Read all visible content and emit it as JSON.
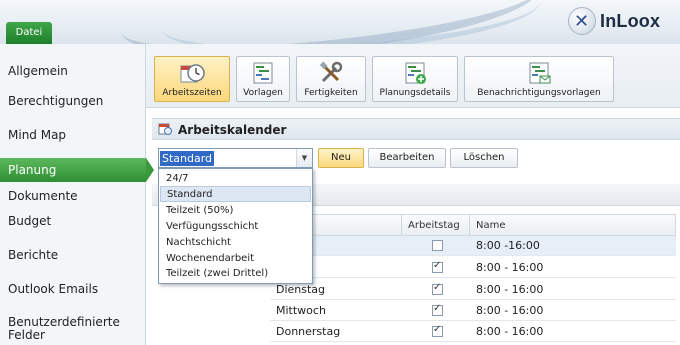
{
  "app": {
    "file_tab": "Datei",
    "brand": "InLoox"
  },
  "sidebar": {
    "items": [
      {
        "label": "Allgemein",
        "active": false
      },
      {
        "label": "Berechtigungen",
        "active": false
      },
      {
        "label": "Mind Map",
        "active": false
      },
      {
        "label": "Planung",
        "active": true
      },
      {
        "label": "Dokumente",
        "active": false
      },
      {
        "label": "Budget",
        "active": false
      },
      {
        "label": "Berichte",
        "active": false
      },
      {
        "label": "Outlook Emails",
        "active": false
      },
      {
        "label": "Benutzerdefinierte Felder",
        "active": false
      }
    ]
  },
  "ribbon": {
    "buttons": [
      {
        "label": "Arbeitszeiten",
        "icon": "clock-calendar-icon",
        "active": true
      },
      {
        "label": "Vorlagen",
        "icon": "template-icon",
        "active": false
      },
      {
        "label": "Fertigkeiten",
        "icon": "tools-icon",
        "active": false
      },
      {
        "label": "Planungsdetails",
        "icon": "planning-details-icon",
        "active": false
      },
      {
        "label": "Benachrichtigungsvorlagen",
        "icon": "notification-template-icon",
        "active": false
      }
    ]
  },
  "section": {
    "title": "Arbeitskalender",
    "icon": "calendar-icon"
  },
  "controls": {
    "calendar_select_value": "Standard",
    "new_label": "Neu",
    "edit_label": "Bearbeiten",
    "delete_label": "Löschen"
  },
  "dropdown": {
    "options": [
      "24/7",
      "Standard",
      "Teilzeit (50%)",
      "Verfügungsschicht",
      "Nachtschicht",
      "Wochenendarbeit",
      "Teilzeit (zwei Drittel)"
    ],
    "selected": "Standard"
  },
  "table": {
    "headers": {
      "day": "Wochentag",
      "workday": "Arbeitstag",
      "name": "Name"
    },
    "header_visible": {
      "day": "tag"
    },
    "rows": [
      {
        "day": "Sonntag",
        "day_visible": "g",
        "workday": false,
        "name": "8:00 -16:00"
      },
      {
        "day": "Montag",
        "day_visible": "g",
        "workday": true,
        "name": "8:00 - 16:00"
      },
      {
        "day": "Dienstag",
        "day_visible": "Dienstag",
        "workday": true,
        "name": "8:00 - 16:00"
      },
      {
        "day": "Mittwoch",
        "day_visible": "Mittwoch",
        "workday": true,
        "name": "8:00 - 16:00"
      },
      {
        "day": "Donnerstag",
        "day_visible": "Donnerstag",
        "workday": true,
        "name": "8:00 - 16:00"
      }
    ]
  },
  "colors": {
    "accent_green": "#2f8f34",
    "selection_blue": "#3169c6",
    "active_button_gold": "#fad77a"
  }
}
